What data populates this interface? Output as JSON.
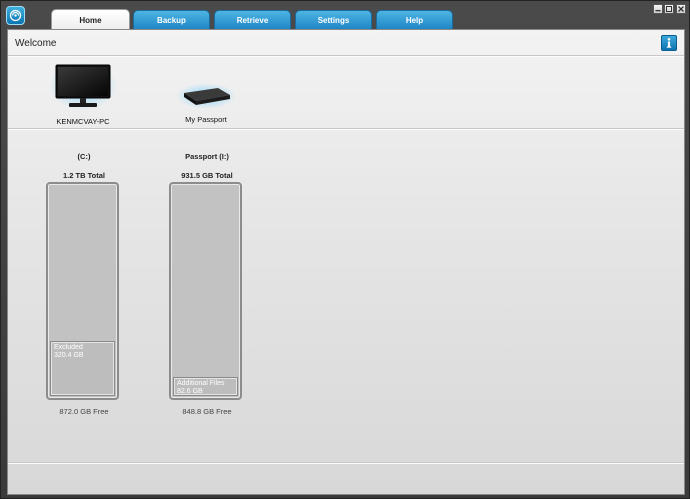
{
  "tabs": [
    {
      "label": "Home",
      "active": true
    },
    {
      "label": "Backup",
      "active": false
    },
    {
      "label": "Retrieve",
      "active": false
    },
    {
      "label": "Settings",
      "active": false
    },
    {
      "label": "Help",
      "active": false
    }
  ],
  "header": {
    "title": "Welcome"
  },
  "devices": [
    {
      "label": "KENMCVAY-PC",
      "icon": "monitor-icon"
    },
    {
      "label": "My Passport",
      "icon": "external-drive-icon"
    }
  ],
  "drives": [
    {
      "name": "(C:)",
      "total": "1.2 TB Total",
      "free": "872.0 GB Free",
      "segment": {
        "label": "Excluded",
        "size": "320.4 GB",
        "fraction": 0.26
      }
    },
    {
      "name": "Passport (I:)",
      "total": "931.5 GB Total",
      "free": "848.8 GB Free",
      "segment": {
        "label": "Additional Files",
        "size": "82.6 GB",
        "fraction": 0.09
      }
    }
  ],
  "colors": {
    "tab_blue": "#1f86c6",
    "accent": "#0d72b0"
  }
}
